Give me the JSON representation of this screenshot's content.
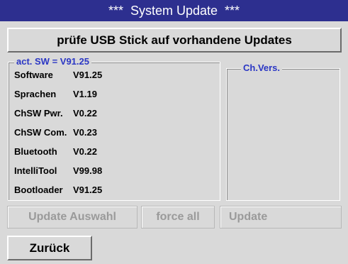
{
  "window": {
    "title": "***  System Update  ***",
    "title_bar_color": "#2d2f8f"
  },
  "check_button": {
    "label": "prüfe USB Stick auf vorhandene Updates"
  },
  "current_software": {
    "legend": "act. SW = V91.25",
    "rows": [
      {
        "label": "Software",
        "value": "V91.25"
      },
      {
        "label": "Sprachen",
        "value": "V1.19"
      },
      {
        "label": "ChSW Pwr.",
        "value": "V0.22"
      },
      {
        "label": "ChSW Com.",
        "value": "V0.23"
      },
      {
        "label": "Bluetooth",
        "value": "V0.22"
      },
      {
        "label": "IntelliTool",
        "value": "V99.98"
      },
      {
        "label": "Bootloader",
        "value": "V91.25"
      }
    ]
  },
  "changelog": {
    "legend": "Ch.Vers."
  },
  "actions": {
    "update_selection_label": "Update Auswahl",
    "force_all_label": "force all",
    "update_label": "Update"
  },
  "back_button": {
    "label": "Zurück"
  },
  "colors": {
    "legend_text": "#2a36c4",
    "disabled_text": "#9a9a9a",
    "background": "#d9d9d9"
  }
}
